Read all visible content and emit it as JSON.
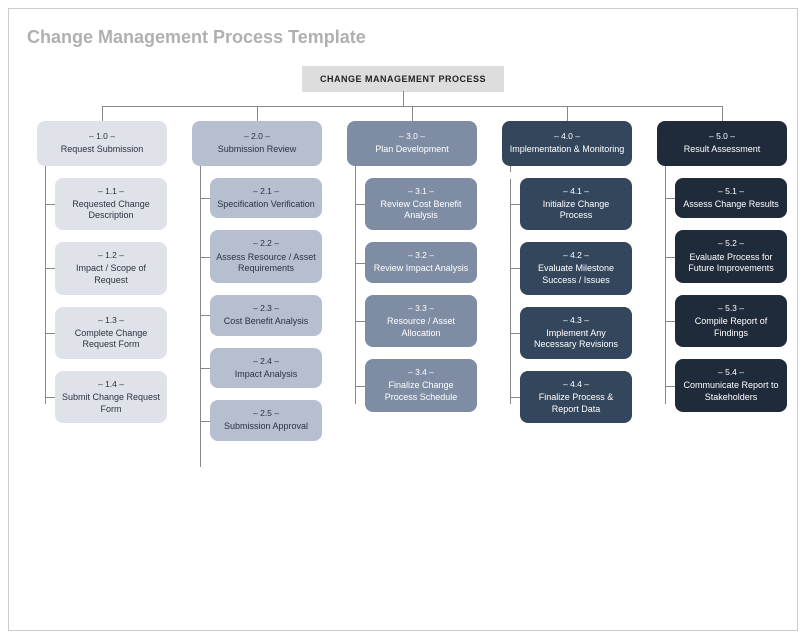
{
  "title": "Change Management Process Template",
  "root": "CHANGE MANAGEMENT PROCESS",
  "columns": [
    {
      "num": "– 1.0 –",
      "label": "Request Submission",
      "steps": [
        {
          "num": "– 1.1 –",
          "label": "Requested Change Description"
        },
        {
          "num": "– 1.2 –",
          "label": "Impact / Scope of Request"
        },
        {
          "num": "– 1.3 –",
          "label": "Complete Change Request Form"
        },
        {
          "num": "– 1.4 –",
          "label": "Submit Change Request Form"
        }
      ]
    },
    {
      "num": "– 2.0 –",
      "label": "Submission Review",
      "steps": [
        {
          "num": "– 2.1 –",
          "label": "Specification Verification"
        },
        {
          "num": "– 2.2 –",
          "label": "Assess Resource / Asset Requirements"
        },
        {
          "num": "– 2.3 –",
          "label": "Cost Benefit Analysis"
        },
        {
          "num": "– 2.4 –",
          "label": "Impact Analysis"
        },
        {
          "num": "– 2.5 –",
          "label": "Submission Approval"
        }
      ]
    },
    {
      "num": "– 3.0 –",
      "label": "Plan Development",
      "steps": [
        {
          "num": "– 3.1 –",
          "label": "Review Cost Benefit Analysis"
        },
        {
          "num": "– 3.2 –",
          "label": "Review Impact Analysis"
        },
        {
          "num": "– 3.3 –",
          "label": "Resource / Asset Allocation"
        },
        {
          "num": "– 3.4 –",
          "label": "Finalize Change Process Schedule"
        }
      ]
    },
    {
      "num": "– 4.0 –",
      "label": "Implementation & Monitoring",
      "steps": [
        {
          "num": "– 4.1 –",
          "label": "Initialize Change Process"
        },
        {
          "num": "– 4.2 –",
          "label": "Evaluate Milestone Success / Issues"
        },
        {
          "num": "– 4.3 –",
          "label": "Implement Any Necessary Revisions"
        },
        {
          "num": "– 4.4 –",
          "label": "Finalize Process & Report Data"
        }
      ]
    },
    {
      "num": "– 5.0 –",
      "label": "Result Assessment",
      "steps": [
        {
          "num": "– 5.1 –",
          "label": "Assess Change Results"
        },
        {
          "num": "– 5.2 –",
          "label": "Evaluate Process for Future Improvements"
        },
        {
          "num": "– 5.3 –",
          "label": "Compile Report of Findings"
        },
        {
          "num": "– 5.4 –",
          "label": "Communicate Report to Stakeholders"
        }
      ]
    }
  ]
}
